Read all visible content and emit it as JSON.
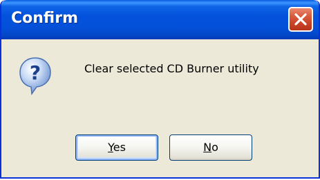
{
  "dialog": {
    "title": "Confirm",
    "message": "Clear selected CD Burner utility",
    "icon": "question-icon",
    "buttons": {
      "yes": {
        "label": "Yes",
        "accel": "Y",
        "rest": "es"
      },
      "no": {
        "label": "No",
        "accel": "N",
        "rest": "o"
      }
    },
    "close_icon": "close-icon"
  },
  "colors": {
    "titlebar": "#0450d9",
    "close_button": "#d95c3d",
    "client_background": "#ece9d8",
    "button_border": "#003c74"
  }
}
